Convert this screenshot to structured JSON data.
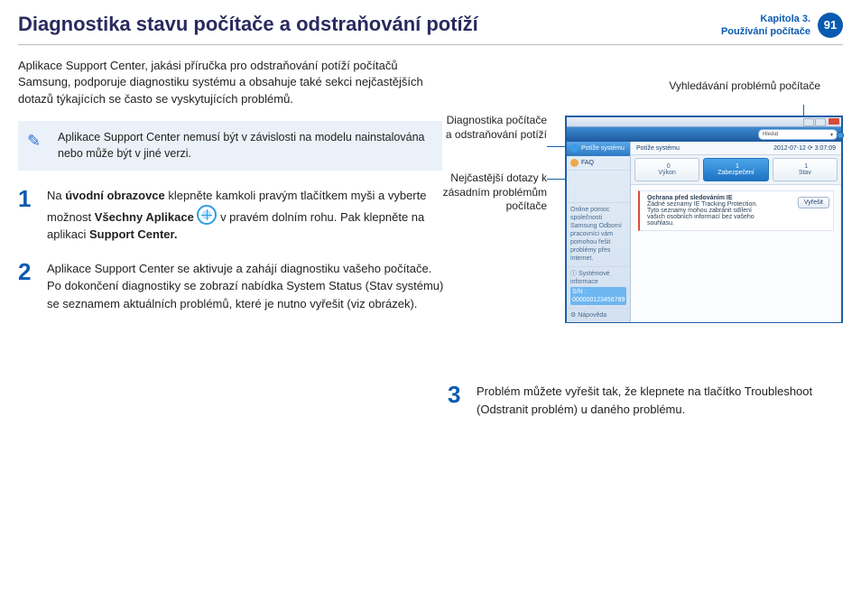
{
  "header": {
    "title": "Diagnostika stavu počítače a odstraňování potíží",
    "chapter_line1": "Kapitola 3.",
    "chapter_line2": "Používání počítače",
    "page_number": "91"
  },
  "intro": "Aplikace Support Center, jakási příručka pro odstraňování potíží počítačů Samsung, podporuje diagnostiku systému a obsahuje také sekci nejčastějších dotazů týkajících se často se vyskytujících problémů.",
  "note": "Aplikace Support Center nemusí být v závislosti na modelu nainstalována nebo může být v jiné verzi.",
  "steps": {
    "s1": {
      "num": "1",
      "pre": "Na ",
      "b1": "úvodní obrazovce",
      "mid": " klepněte kamkoli pravým tlačítkem myši a vyberte možnost ",
      "b2": "Všechny Aplikace",
      "post1": " v pravém dolním rohu. Pak klepněte na aplikaci ",
      "b3": "Support Center."
    },
    "s2": {
      "num": "2",
      "line1": "Aplikace Support Center se aktivuje a zahájí diagnostiku vašeho počítače.",
      "line2": "Po dokončení diagnostiky se zobrazí nabídka System Status (Stav systému) se seznamem aktuálních problémů, které je nutno vyřešit (viz obrázek)."
    },
    "s3": {
      "num": "3",
      "text": "Problém můžete vyřešit tak, že klepnete na tlačítko Troubleshoot (Odstranit problém) u daného problému."
    }
  },
  "callouts": {
    "search": "Vyhledávání problémů počítače",
    "diag": "Diagnostika počítače a odstraňování potíží",
    "faq": "Nejčastější dotazy k zásadním problémům počítače"
  },
  "window": {
    "search_placeholder": "Hledat",
    "side": {
      "item1": "Potíže systému",
      "item2": "FAQ",
      "contact": "Online pomoc společnosti Samsung\nOdborní pracovníci vám pomohou řešit problémy přes internet.",
      "sysinfo_label": "Systémové informace",
      "sysinfo_sn": "S/N : 000000123456789",
      "settings": "Nápověda"
    },
    "main": {
      "title": "Potíže systému",
      "timestamp": "2012-07-12  ⟳ 3:07:09",
      "tabs": {
        "t1": {
          "label": "Výkon",
          "count": "0"
        },
        "t2": {
          "label": "Zabezpečení",
          "count": "1"
        },
        "t3": {
          "label": "Stav",
          "count": "1"
        }
      },
      "issue": {
        "title": "Ochrana před sledováním IE",
        "desc": "Žádné seznamy IE Tracking Protection. Tyto seznamy mohou zabránit sdílení vašich osobních informací bez vašeho souhlasu.",
        "btn": "Vyřešit"
      }
    }
  }
}
